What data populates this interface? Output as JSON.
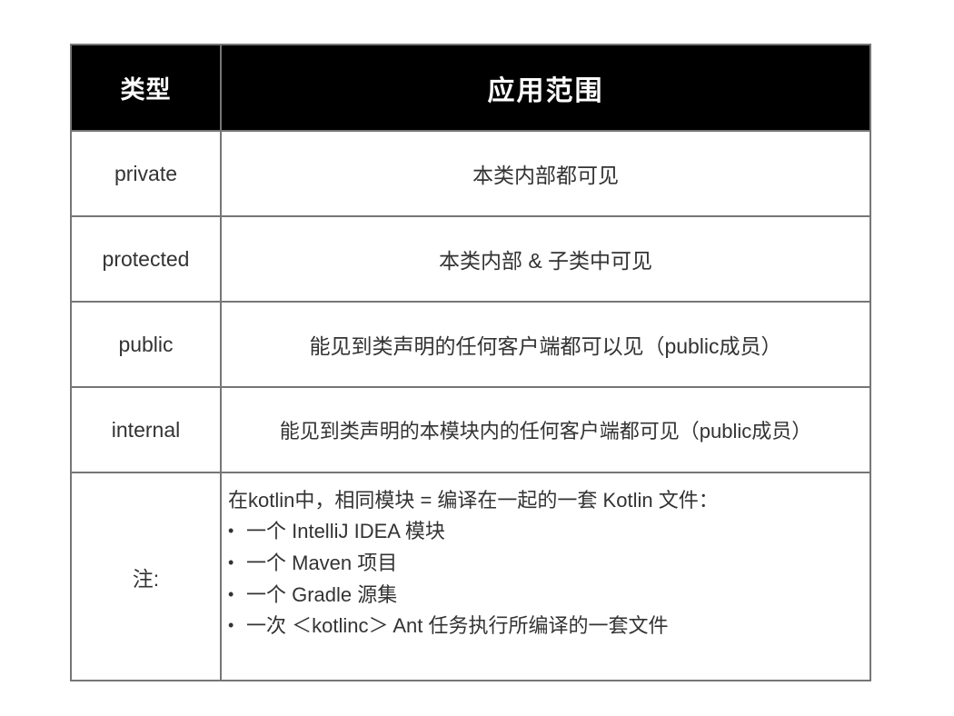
{
  "table": {
    "headers": {
      "type": "类型",
      "scope": "应用范围"
    },
    "rows": [
      {
        "type": "private",
        "scope": "本类内部都可见"
      },
      {
        "type": "protected",
        "scope": "本类内部 & 子类中可见"
      },
      {
        "type": "public",
        "scope": "能见到类声明的任何客户端都可以见（public成员）"
      },
      {
        "type": "internal",
        "scope": "能见到类声明的本模块内的任何客户端都可见（public成员）"
      }
    ],
    "note": {
      "label": "注:",
      "heading": "在kotlin中，相同模块 = 编译在一起的一套 Kotlin 文件：",
      "bullets": [
        "一个 IntelliJ IDEA 模块",
        "一个 Maven 项目",
        "一个 Gradle 源集",
        "一次 ＜kotlinc＞ Ant 任务执行所编译的一套文件"
      ]
    }
  },
  "colors": {
    "page_background": "#ffffff",
    "header_background": "#000000",
    "header_text": "#ffffff",
    "border": "#767676",
    "body_text": "#333333"
  }
}
